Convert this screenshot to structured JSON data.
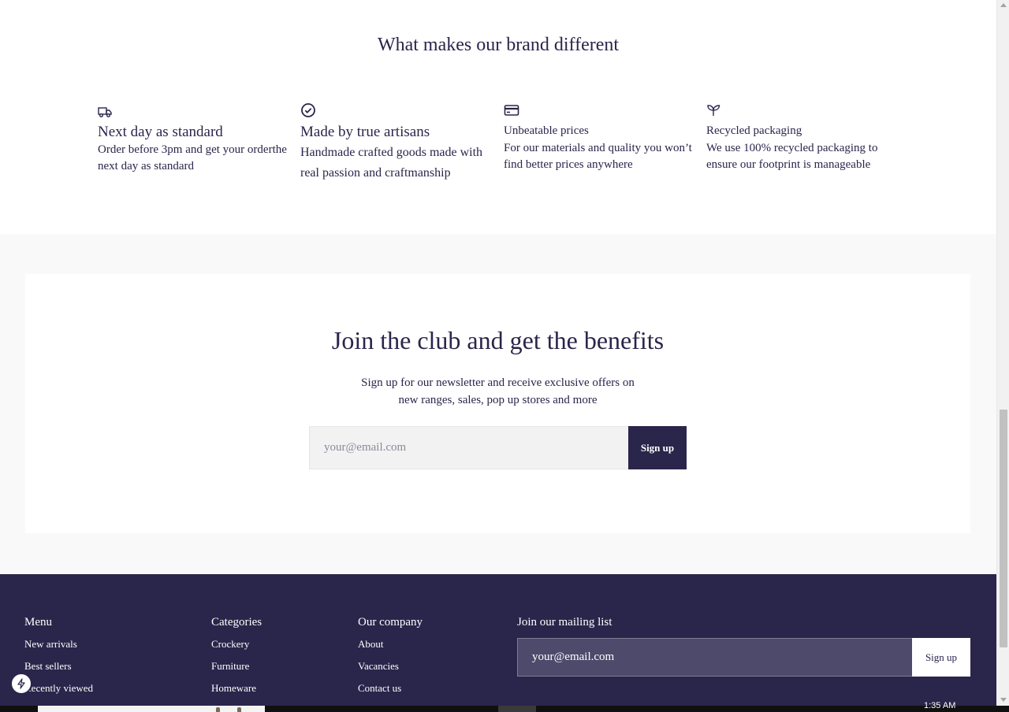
{
  "features": {
    "title": "What makes our brand different",
    "items": [
      {
        "icon": "delivery-truck-icon",
        "title": "Next day as standard",
        "description": "Order before 3pm and get your orderthe next day as standard"
      },
      {
        "icon": "checkmark-circle-icon",
        "title": "Made by true artisans",
        "description": "Handmade crafted goods made with real passion and craftmanship"
      },
      {
        "icon": "credit-card-icon",
        "title": "Unbeatable prices",
        "description": "For our materials and quality you won’t find better prices anywhere"
      },
      {
        "icon": "sprout-icon",
        "title": "Recycled packaging",
        "description": "We use 100% recycled packaging to ensure our footprint is manageable"
      }
    ]
  },
  "newsletter": {
    "title": "Join the club and get the benefits",
    "text_line1": "Sign up for our newsletter and receive exclusive offers on",
    "text_line2": "new ranges, sales, pop up stores and more",
    "placeholder": "your@email.com",
    "button_label": "Sign up"
  },
  "footer": {
    "menu": {
      "heading": "Menu",
      "links": [
        "New arrivals",
        "Best sellers",
        "Recently viewed"
      ]
    },
    "categories": {
      "heading": "Categories",
      "links": [
        "Crockery",
        "Furniture",
        "Homeware"
      ]
    },
    "company": {
      "heading": "Our company",
      "links": [
        "About",
        "Vacancies",
        "Contact us"
      ]
    },
    "mailing": {
      "heading": "Join our mailing list",
      "placeholder": "your@email.com",
      "button_label": "Sign up"
    }
  },
  "colors": {
    "brand_dark": "#2a254b",
    "section_bg": "#f9f9f9",
    "input_bg": "#f2f2f2"
  },
  "taskbar": {
    "clock": "1:35 AM"
  }
}
